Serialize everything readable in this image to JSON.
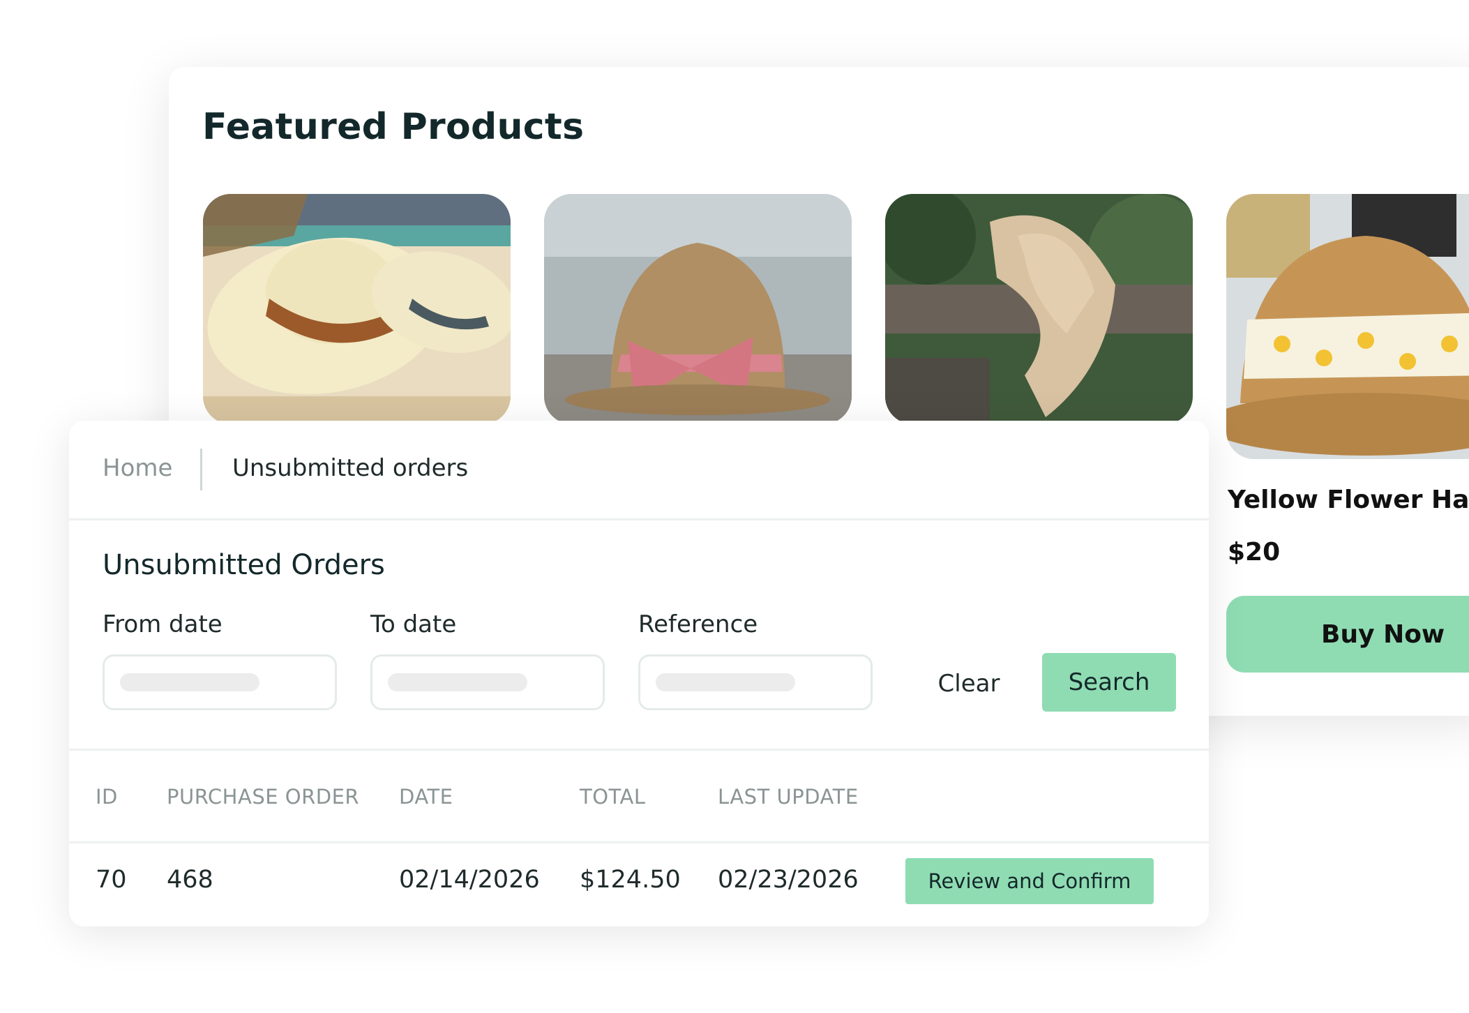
{
  "featured": {
    "title": "Featured Products",
    "products": [
      {
        "image": "cream-sun-hat-beach-photo"
      },
      {
        "image": "straw-hat-pink-bow-photo"
      },
      {
        "image": "cowboy-hat-on-post-photo"
      },
      {
        "image": "yellow-flower-hat-photo",
        "name": "Yellow Flower Hat",
        "price": "$20",
        "button": "Buy Now"
      }
    ]
  },
  "orders": {
    "breadcrumb": {
      "home": "Home",
      "current": "Unsubmitted orders"
    },
    "title": "Unsubmitted Orders",
    "filters": {
      "from_label": "From date",
      "to_label": "To date",
      "reference_label": "Reference",
      "clear": "Clear",
      "search": "Search"
    },
    "table": {
      "headers": [
        "ID",
        "PURCHASE ORDER",
        "DATE",
        "TOTAL",
        "LAST UPDATE"
      ],
      "rows": [
        {
          "id": "70",
          "purchase_order": "468",
          "date": "02/14/2026",
          "total": "$124.50",
          "last_update": "02/23/2026",
          "action": "Review and Confirm"
        }
      ]
    }
  },
  "colors": {
    "accent": "#8fdcb3",
    "muted_text": "#8a9494",
    "dark_text": "#13282a"
  }
}
